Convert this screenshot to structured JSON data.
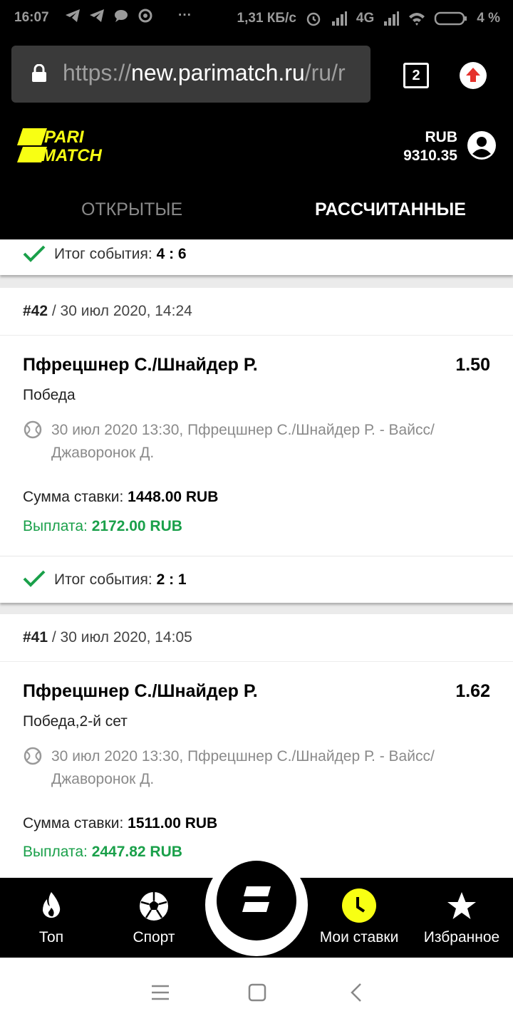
{
  "status_bar": {
    "time": "16:07",
    "dots": "···",
    "speed": "1,31 КБ/с",
    "network": "4G",
    "battery": "4 %"
  },
  "browser": {
    "url_scheme": "https://",
    "url_host": "new.parimatch.ru",
    "url_path": "/ru/r",
    "tab_count": "2"
  },
  "header": {
    "logo_line1": "PARI",
    "logo_line2": "MATCH",
    "currency": "RUB",
    "balance": "9310.35"
  },
  "tabs": {
    "open": "ОТКРЫТЫЕ",
    "settled": "РАССЧИТАННЫЕ"
  },
  "bets": [
    {
      "result_label": "Итог события:",
      "result_score": "4 : 6"
    },
    {
      "number": "#42",
      "date": "/ 30 июл 2020, 14:24",
      "event": "Пфрецшнер С./Шнайдер Р.",
      "odds": "1.50",
      "market": "Победа",
      "meta_line1": "30 июл 2020 13:30, Пфрецшнер С./Шнайдер Р. - Вайсс/",
      "meta_line2": "Джаворонок Д.",
      "stake_label": "Сумма ставки:",
      "stake_value": "1448.00 RUB",
      "payout_label": "Выплата:",
      "payout_value": "2172.00 RUB",
      "result_label": "Итог события:",
      "result_score": "2 : 1"
    },
    {
      "number": "#41",
      "date": "/ 30 июл 2020, 14:05",
      "event": "Пфрецшнер С./Шнайдер Р.",
      "odds": "1.62",
      "market": "Победа,2-й сет",
      "meta_line1": "30 июл 2020 13:30, Пфрецшнер С./Шнайдер Р. - Вайсс/",
      "meta_line2": "Джаворонок Д.",
      "stake_label": "Сумма ставки:",
      "stake_value": "1511.00 RUB",
      "payout_label": "Выплата:",
      "payout_value": "2447.82 RUB"
    }
  ],
  "bottom_nav": {
    "top": "Топ",
    "sport": "Спорт",
    "my_bets": "Мои ставки",
    "favorites": "Избранное"
  },
  "colors": {
    "brand_yellow": "#f8ff13",
    "win_green": "#1aa04a",
    "check_green": "#1aa04a"
  }
}
